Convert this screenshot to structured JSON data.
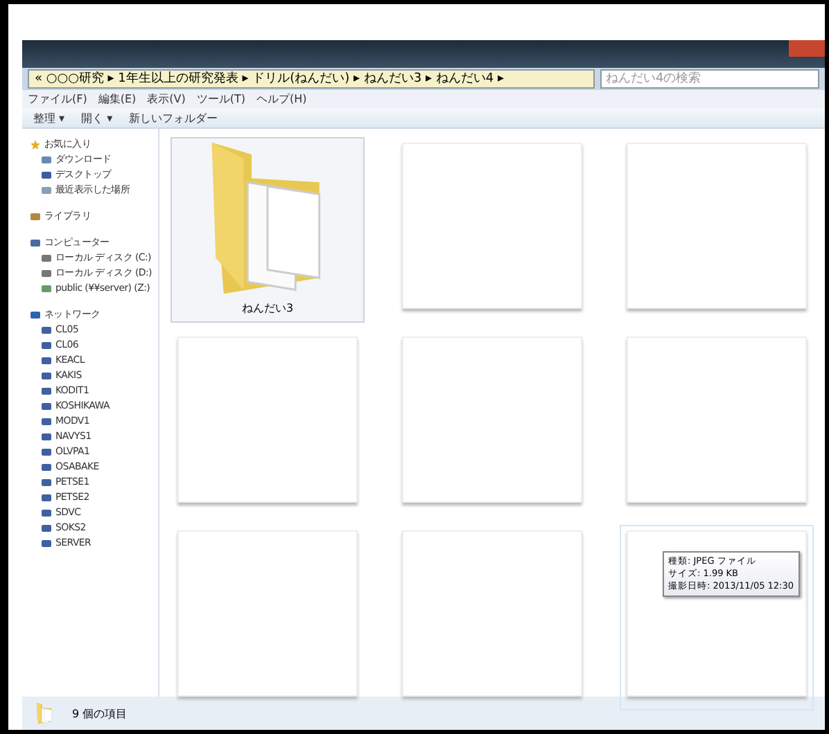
{
  "address_bar": {
    "path": "« ○○○研究 ▸ 1年生以上の研究発表 ▸ ドリル(ねんだい) ▸ ねんだい3 ▸ ねんだい4 ▸"
  },
  "search": {
    "placeholder": "ねんだい4の検索"
  },
  "menu": [
    "ファイル(F)",
    "編集(E)",
    "表示(V)",
    "ツール(T)",
    "ヘルプ(H)"
  ],
  "toolbar": [
    "整理 ▾",
    "開く ▾",
    "新しいフォルダー"
  ],
  "sidebar": [
    {
      "label": "お気に入り",
      "kind": "star",
      "children": [
        {
          "label": "ダウンロード",
          "kind": "download"
        },
        {
          "label": "デスクトップ",
          "kind": "desktop"
        },
        {
          "label": "最近表示した場所",
          "kind": "recent"
        }
      ]
    },
    {
      "label": "ライブラリ",
      "kind": "library"
    },
    {
      "label": "コンピューター",
      "kind": "computer",
      "children": [
        {
          "label": "ローカル ディスク (C:)",
          "kind": "disk"
        },
        {
          "label": "ローカル ディスク (D:)",
          "kind": "disk"
        },
        {
          "label": "public (¥¥server) (Z:)",
          "kind": "netdrive"
        }
      ]
    },
    {
      "label": "ネットワーク",
      "kind": "network",
      "children": [
        {
          "label": "CL05",
          "kind": "pc"
        },
        {
          "label": "CL06",
          "kind": "pc"
        },
        {
          "label": "KEACL",
          "kind": "pc"
        },
        {
          "label": "KAKIS",
          "kind": "pc"
        },
        {
          "label": "KODIT1",
          "kind": "pc"
        },
        {
          "label": "KOSHIKAWA",
          "kind": "pc"
        },
        {
          "label": "MODV1",
          "kind": "pc"
        },
        {
          "label": "NAVYS1",
          "kind": "pc"
        },
        {
          "label": "OLVPA1",
          "kind": "pc"
        },
        {
          "label": "OSABAKE",
          "kind": "pc"
        },
        {
          "label": "PETSE1",
          "kind": "pc"
        },
        {
          "label": "PETSE2",
          "kind": "pc"
        },
        {
          "label": "SDVC",
          "kind": "pc"
        },
        {
          "label": "SOKS2",
          "kind": "pc"
        },
        {
          "label": "SERVER",
          "kind": "pc"
        }
      ]
    }
  ],
  "items": [
    {
      "kind": "folder",
      "label": "ねんだい3",
      "selected": true
    },
    {
      "kind": "image",
      "selected": false
    },
    {
      "kind": "image",
      "selected": false
    },
    {
      "kind": "image",
      "selected": false
    },
    {
      "kind": "image",
      "selected": false
    },
    {
      "kind": "image",
      "selected": false
    },
    {
      "kind": "image",
      "selected": false
    },
    {
      "kind": "image",
      "selected": false
    },
    {
      "kind": "image",
      "selected": false,
      "hovered": true
    }
  ],
  "tooltip": [
    "種類: JPEG ファイル",
    "サイズ: 1.99 KB",
    "撮影日時: 2013/11/05 12:30"
  ],
  "status_bar": {
    "text": "9 個の項目"
  }
}
